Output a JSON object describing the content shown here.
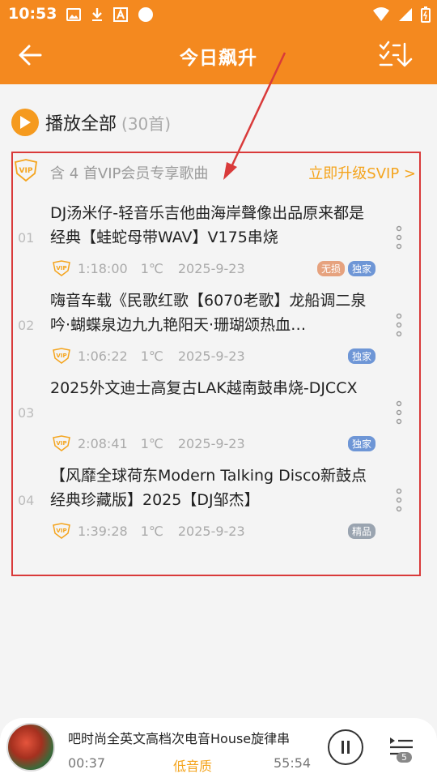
{
  "status": {
    "time": "10:53"
  },
  "header": {
    "title": "今日飙升"
  },
  "play_all": {
    "label": "播放全部",
    "count": "(30首)"
  },
  "vip": {
    "notice": "含 4 首VIP会员专享歌曲",
    "upgrade": "立即升级SVIP >"
  },
  "songs": [
    {
      "index": "01",
      "title": "DJ汤米仔-轻音乐吉他曲海岸聲像出品原来都是经典【蛙蛇母带WAV】V175串烧",
      "duration": "1:18:00",
      "temp": "1℃",
      "date": "2025-9-23",
      "tags": [
        "无损",
        "独家"
      ]
    },
    {
      "index": "02",
      "title": "嗨音车载《民歌红歌【6070老歌】龙船调二泉吟·蝴蝶泉边九九艳阳天·珊瑚颂热血…",
      "duration": "1:06:22",
      "temp": "1℃",
      "date": "2025-9-23",
      "tags": [
        "独家"
      ]
    },
    {
      "index": "03",
      "title": "2025外文迪士高复古LAK越南鼓串烧-DJCCX",
      "duration": "2:08:41",
      "temp": "1℃",
      "date": "2025-9-23",
      "tags": [
        "独家"
      ]
    },
    {
      "index": "04",
      "title": "【风靡全球荷东Modern Talking Disco新鼓点经典珍藏版】2025【DJ邹杰】",
      "duration": "1:39:28",
      "temp": "1℃",
      "date": "2025-9-23",
      "tags": [
        "精品"
      ]
    }
  ],
  "player": {
    "title": "吧时尚全英文高档次电音House旋律串",
    "current": "00:37",
    "quality": "低音质",
    "total": "55:54",
    "queue_count": "5"
  },
  "colors": {
    "brand": "#f4891f",
    "vip_gold": "#f4a41d",
    "annotation": "#d93a3a"
  }
}
